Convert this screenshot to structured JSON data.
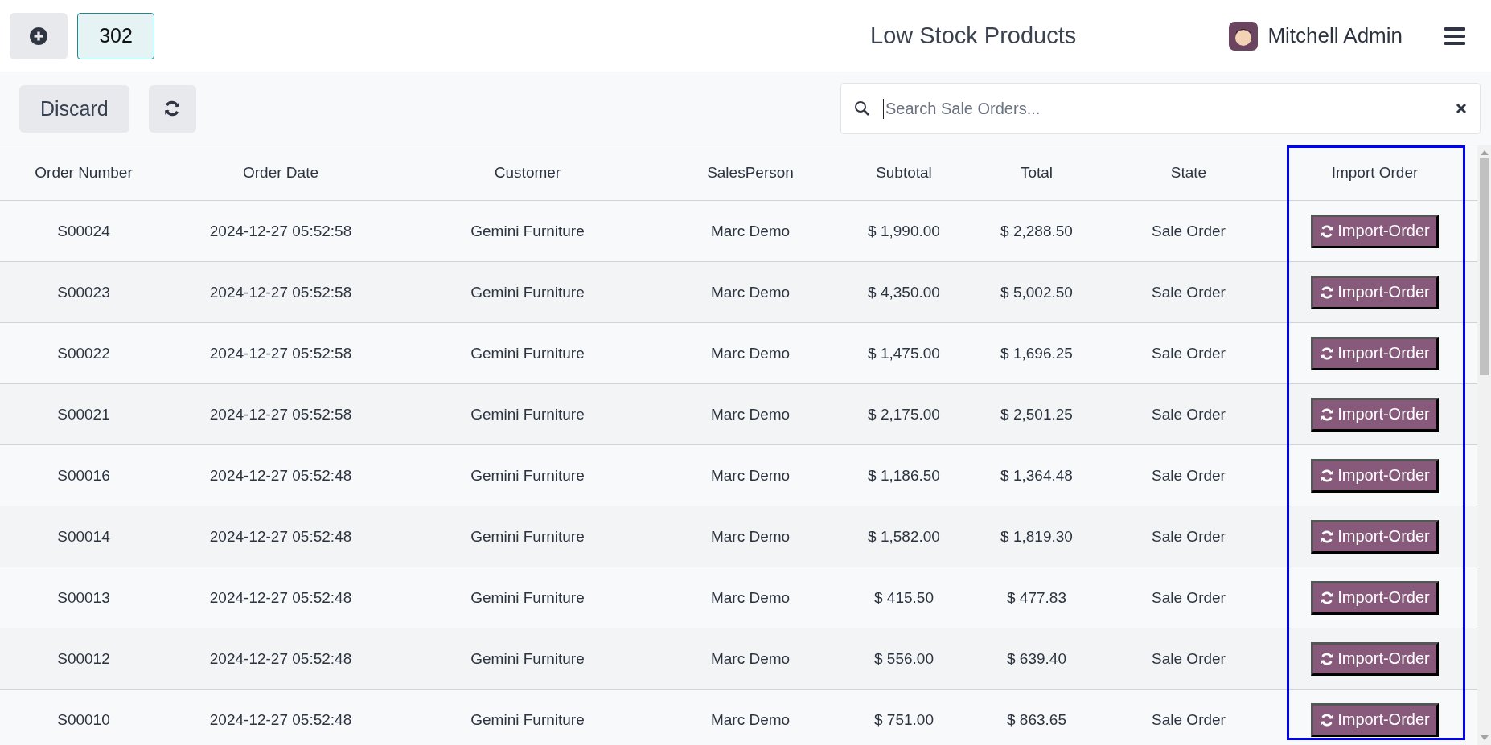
{
  "top_bar": {
    "counter": "302",
    "title": "Low Stock Products",
    "user": "Mitchell Admin"
  },
  "toolbar": {
    "discard": "Discard",
    "search": {
      "placeholder": "Search Sale Orders..."
    }
  },
  "table": {
    "columns": [
      "Order Number",
      "Order Date",
      "Customer",
      "SalesPerson",
      "Subtotal",
      "Total",
      "State",
      "Import Order"
    ],
    "rows": [
      {
        "cells": [
          "S00024",
          "2024-12-27 05:52:58",
          "Gemini Furniture",
          "Marc Demo",
          "$ 1,990.00",
          "$ 2,288.50",
          "Sale Order"
        ],
        "action": "Import-Order"
      },
      {
        "cells": [
          "S00023",
          "2024-12-27 05:52:58",
          "Gemini Furniture",
          "Marc Demo",
          "$ 4,350.00",
          "$ 5,002.50",
          "Sale Order"
        ],
        "action": "Import-Order"
      },
      {
        "cells": [
          "S00022",
          "2024-12-27 05:52:58",
          "Gemini Furniture",
          "Marc Demo",
          "$ 1,475.00",
          "$ 1,696.25",
          "Sale Order"
        ],
        "action": "Import-Order"
      },
      {
        "cells": [
          "S00021",
          "2024-12-27 05:52:58",
          "Gemini Furniture",
          "Marc Demo",
          "$ 2,175.00",
          "$ 2,501.25",
          "Sale Order"
        ],
        "action": "Import-Order"
      },
      {
        "cells": [
          "S00016",
          "2024-12-27 05:52:48",
          "Gemini Furniture",
          "Marc Demo",
          "$ 1,186.50",
          "$ 1,364.48",
          "Sale Order"
        ],
        "action": "Import-Order"
      },
      {
        "cells": [
          "S00014",
          "2024-12-27 05:52:48",
          "Gemini Furniture",
          "Marc Demo",
          "$ 1,582.00",
          "$ 1,819.30",
          "Sale Order"
        ],
        "action": "Import-Order"
      },
      {
        "cells": [
          "S00013",
          "2024-12-27 05:52:48",
          "Gemini Furniture",
          "Marc Demo",
          "$ 415.50",
          "$ 477.83",
          "Sale Order"
        ],
        "action": "Import-Order"
      },
      {
        "cells": [
          "S00012",
          "2024-12-27 05:52:48",
          "Gemini Furniture",
          "Marc Demo",
          "$ 556.00",
          "$ 639.40",
          "Sale Order"
        ],
        "action": "Import-Order"
      },
      {
        "cells": [
          "S00010",
          "2024-12-27 05:52:48",
          "Gemini Furniture",
          "Marc Demo",
          "$ 751.00",
          "$ 863.65",
          "Sale Order"
        ],
        "action": "Import-Order"
      }
    ]
  }
}
